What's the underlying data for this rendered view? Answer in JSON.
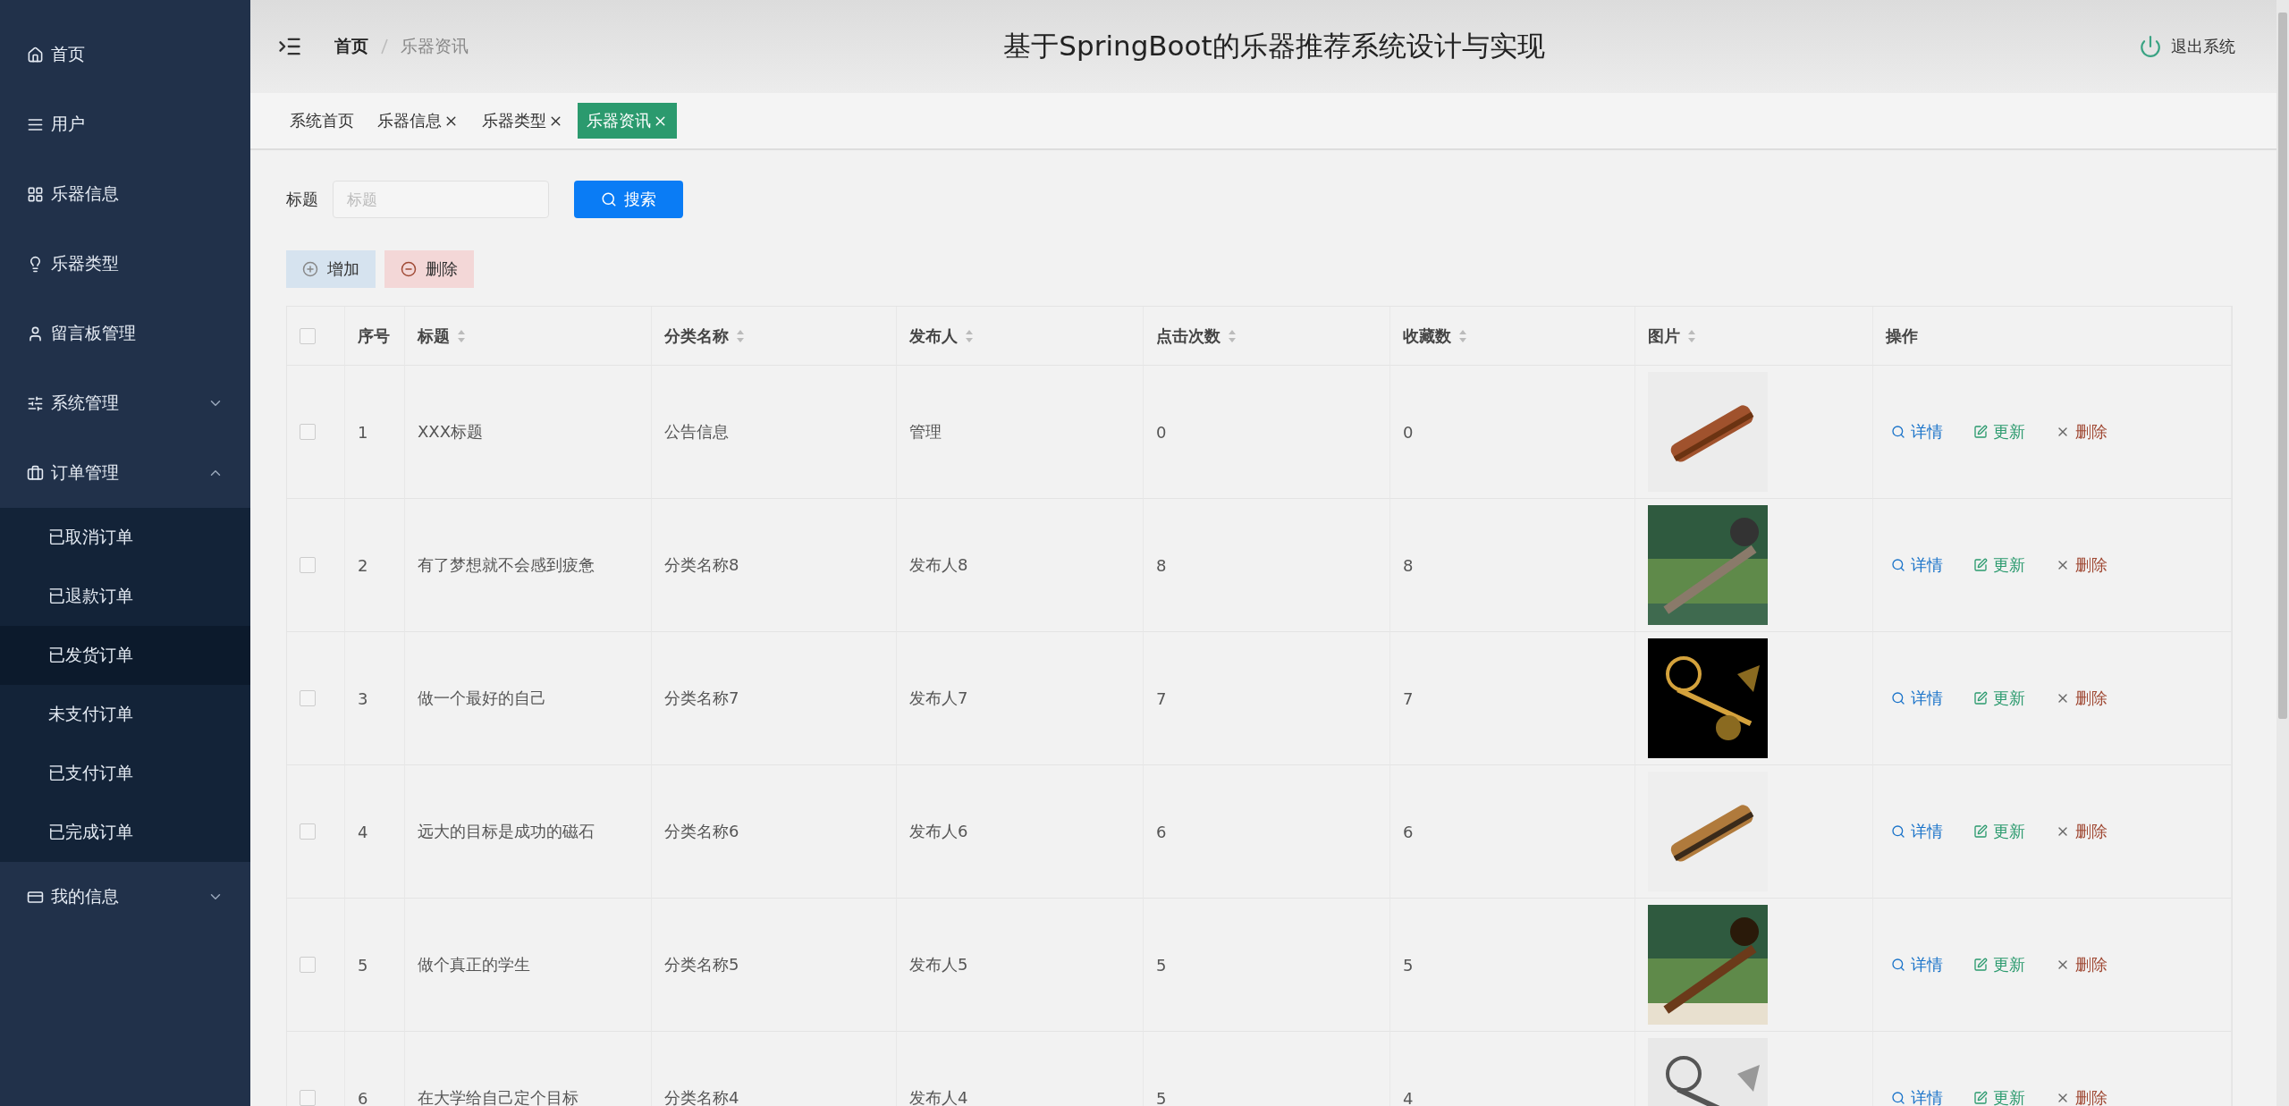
{
  "sidebar": {
    "items": [
      {
        "kind": "link",
        "label": "首页"
      },
      {
        "kind": "link",
        "label": "用户"
      },
      {
        "kind": "link",
        "label": "乐器信息"
      },
      {
        "kind": "link",
        "label": "乐器类型"
      },
      {
        "kind": "link",
        "label": "留言板管理"
      },
      {
        "kind": "group",
        "label": "系统管理",
        "expanded": false
      },
      {
        "kind": "group",
        "label": "订单管理",
        "expanded": true,
        "children": [
          {
            "label": "已取消订单",
            "selected": false
          },
          {
            "label": "已退款订单",
            "selected": false
          },
          {
            "label": "已发货订单",
            "selected": true
          },
          {
            "label": "未支付订单",
            "selected": false
          },
          {
            "label": "已支付订单",
            "selected": false
          },
          {
            "label": "已完成订单",
            "selected": false
          }
        ]
      },
      {
        "kind": "group",
        "label": "我的信息",
        "expanded": false
      }
    ]
  },
  "header": {
    "breadcrumb": [
      "首页",
      "乐器资讯"
    ],
    "title": "基于SpringBoot的乐器推荐系统设计与实现",
    "logout": "退出系统"
  },
  "tabs": [
    {
      "label": "系统首页",
      "closable": false,
      "selected": false
    },
    {
      "label": "乐器信息",
      "closable": true,
      "selected": false
    },
    {
      "label": "乐器类型",
      "closable": true,
      "selected": false
    },
    {
      "label": "乐器资讯",
      "closable": true,
      "selected": true
    }
  ],
  "search": {
    "label": "标题",
    "placeholder": "标题",
    "button": "搜索"
  },
  "toolbar": [
    {
      "kind": "add",
      "label": "增加"
    },
    {
      "kind": "delete",
      "label": "删除"
    }
  ],
  "table": {
    "select_all_checked": false,
    "columns": [
      {
        "label": "序号",
        "sortable": false
      },
      {
        "label": "标题",
        "sortable": true
      },
      {
        "label": "分类名称",
        "sortable": true
      },
      {
        "label": "发布人",
        "sortable": true
      },
      {
        "label": "点击次数",
        "sortable": true
      },
      {
        "label": "收藏数",
        "sortable": true
      },
      {
        "label": "图片",
        "sortable": true
      },
      {
        "label": "操作",
        "sortable": false
      }
    ],
    "rows": [
      {
        "checked": false,
        "cells": [
          "1",
          "XXX标题",
          "公告信息",
          "管理",
          "0",
          "0"
        ],
        "image": {
          "kind": "picture"
        },
        "actions": [
          {
            "kind": "detail",
            "label": "详情"
          },
          {
            "kind": "edit",
            "label": "更新"
          },
          {
            "kind": "delete",
            "label": "删除"
          }
        ]
      },
      {
        "checked": false,
        "cells": [
          "2",
          "有了梦想就不会感到疲惫",
          "分类名称8",
          "发布人8",
          "8",
          "8"
        ],
        "image": {
          "kind": "picture"
        },
        "actions": [
          {
            "kind": "detail",
            "label": "详情"
          },
          {
            "kind": "edit",
            "label": "更新"
          },
          {
            "kind": "delete",
            "label": "删除"
          }
        ]
      },
      {
        "checked": false,
        "cells": [
          "3",
          "做一个最好的自己",
          "分类名称7",
          "发布人7",
          "7",
          "7"
        ],
        "image": {
          "kind": "picture"
        },
        "actions": [
          {
            "kind": "detail",
            "label": "详情"
          },
          {
            "kind": "edit",
            "label": "更新"
          },
          {
            "kind": "delete",
            "label": "删除"
          }
        ]
      },
      {
        "checked": false,
        "cells": [
          "4",
          "远大的目标是成功的磁石",
          "分类名称6",
          "发布人6",
          "6",
          "6"
        ],
        "image": {
          "kind": "picture"
        },
        "actions": [
          {
            "kind": "detail",
            "label": "详情"
          },
          {
            "kind": "edit",
            "label": "更新"
          },
          {
            "kind": "delete",
            "label": "删除"
          }
        ]
      },
      {
        "checked": false,
        "cells": [
          "5",
          "做个真正的学生",
          "分类名称5",
          "发布人5",
          "5",
          "5"
        ],
        "image": {
          "kind": "picture"
        },
        "actions": [
          {
            "kind": "detail",
            "label": "详情"
          },
          {
            "kind": "edit",
            "label": "更新"
          },
          {
            "kind": "delete",
            "label": "删除"
          }
        ]
      },
      {
        "checked": false,
        "cells": [
          "6",
          "在大学给自己定个目标",
          "分类名称4",
          "发布人4",
          "5",
          "4"
        ],
        "image": {
          "kind": "picture"
        },
        "actions": [
          {
            "kind": "detail",
            "label": "详情"
          },
          {
            "kind": "edit",
            "label": "更新"
          },
          {
            "kind": "delete",
            "label": "删除"
          }
        ]
      }
    ]
  }
}
